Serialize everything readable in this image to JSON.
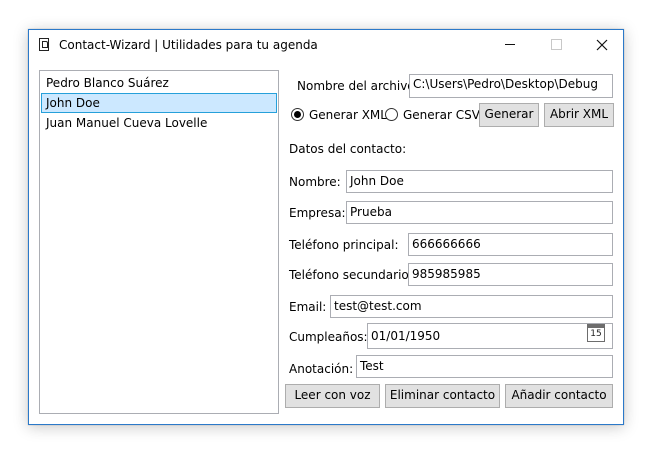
{
  "window": {
    "title": "Contact-Wizard | Utilidades para tu agenda",
    "icons": {
      "app": "notebook-icon",
      "minimize": "minimize-icon",
      "maximize": "maximize-icon",
      "close": "close-icon"
    }
  },
  "contacts": {
    "items": [
      {
        "label": "Pedro Blanco Suárez"
      },
      {
        "label": "John Doe"
      },
      {
        "label": "Juan Manuel Cueva Lovelle"
      }
    ],
    "selected": "John Doe"
  },
  "export": {
    "filename_label": "Nombre del archivo:",
    "filename_value": "C:\\Users\\Pedro\\Desktop\\Debug",
    "xml_label": "Generar XML",
    "csv_label": "Generar CSV",
    "selected_format": "xml",
    "generate_button": "Generar",
    "open_xml_button": "Abrir XML"
  },
  "details": {
    "section_title": "Datos del contacto:",
    "nombre_label": "Nombre:",
    "nombre_value": "John Doe",
    "empresa_label": "Empresa:",
    "empresa_value": "Prueba",
    "tel_principal_label": "Teléfono principal:",
    "tel_principal_value": "666666666",
    "tel_secundario_label": "Teléfono secundario:",
    "tel_secundario_value": "985985985",
    "email_label": "Email:",
    "email_value": "test@test.com",
    "cumple_label": "Cumpleaños:",
    "cumple_value": "01/01/1950",
    "calendar_day": "15",
    "anotacion_label": "Anotación:",
    "anotacion_value": "Test"
  },
  "actions": {
    "read_aloud": "Leer con voz",
    "delete": "Eliminar contacto",
    "add": "Añadir contacto"
  },
  "colors": {
    "window_border": "#2b79c9",
    "selection_bg": "#cce8ff",
    "selection_border": "#26a0da",
    "button_bg": "#e1e1e1"
  }
}
